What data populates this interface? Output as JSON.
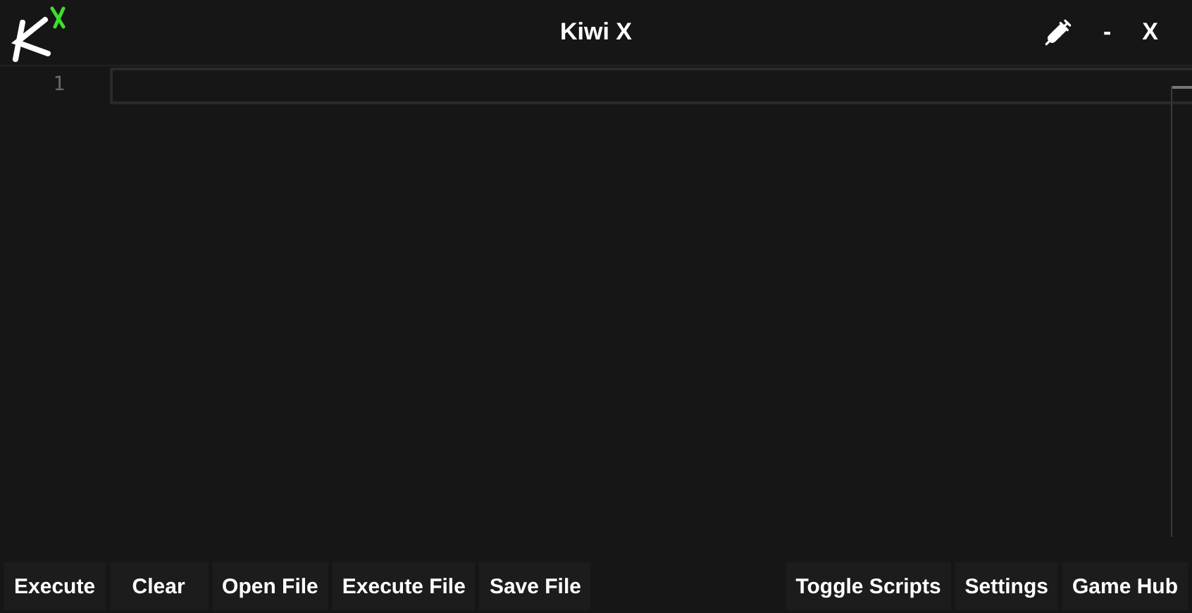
{
  "window": {
    "title": "Kiwi X",
    "controls": [
      "-",
      "X"
    ]
  },
  "editor": {
    "line_numbers": [
      "1"
    ]
  },
  "toolbar": {
    "left": [
      "Execute",
      "Clear",
      "Open File",
      "Execute File",
      "Save File"
    ],
    "right": [
      "Toggle Scripts",
      "Settings",
      "Game Hub"
    ]
  }
}
